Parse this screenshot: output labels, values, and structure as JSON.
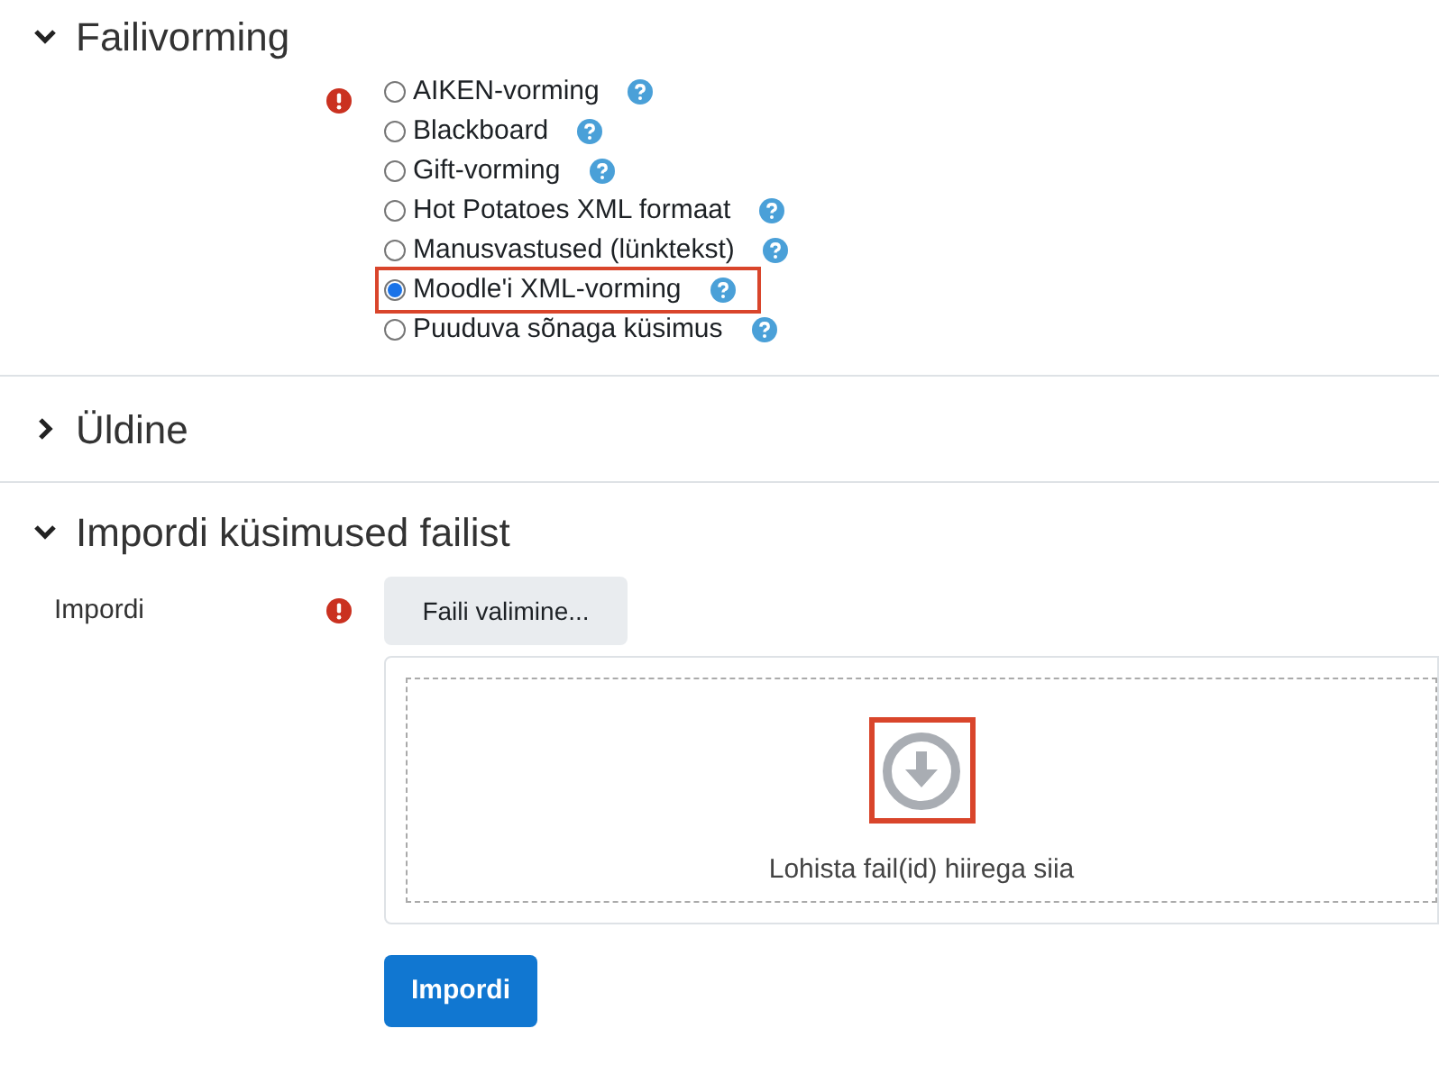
{
  "sections": [
    {
      "title": "Failivorming",
      "expanded": true
    },
    {
      "title": "Üldine",
      "expanded": false
    },
    {
      "title": "Impordi küsimused failist",
      "expanded": true
    }
  ],
  "format_options": [
    {
      "label": "AIKEN-vorming",
      "selected": false,
      "highlighted": false
    },
    {
      "label": "Blackboard",
      "selected": false,
      "highlighted": false
    },
    {
      "label": "Gift-vorming",
      "selected": false,
      "highlighted": false
    },
    {
      "label": "Hot Potatoes XML formaat",
      "selected": false,
      "highlighted": false
    },
    {
      "label": "Manusvastused (lünktekst)",
      "selected": false,
      "highlighted": false
    },
    {
      "label": "Moodle'i XML-vorming",
      "selected": true,
      "highlighted": true
    },
    {
      "label": "Puuduva sõnaga küsimus",
      "selected": false,
      "highlighted": false
    }
  ],
  "import_field": {
    "label": "Impordi",
    "choose_button": "Faili valimine...",
    "dropzone_text": "Lohista fail(id) hiirega siia",
    "icon_highlighted": true
  },
  "submit_button": "Impordi"
}
